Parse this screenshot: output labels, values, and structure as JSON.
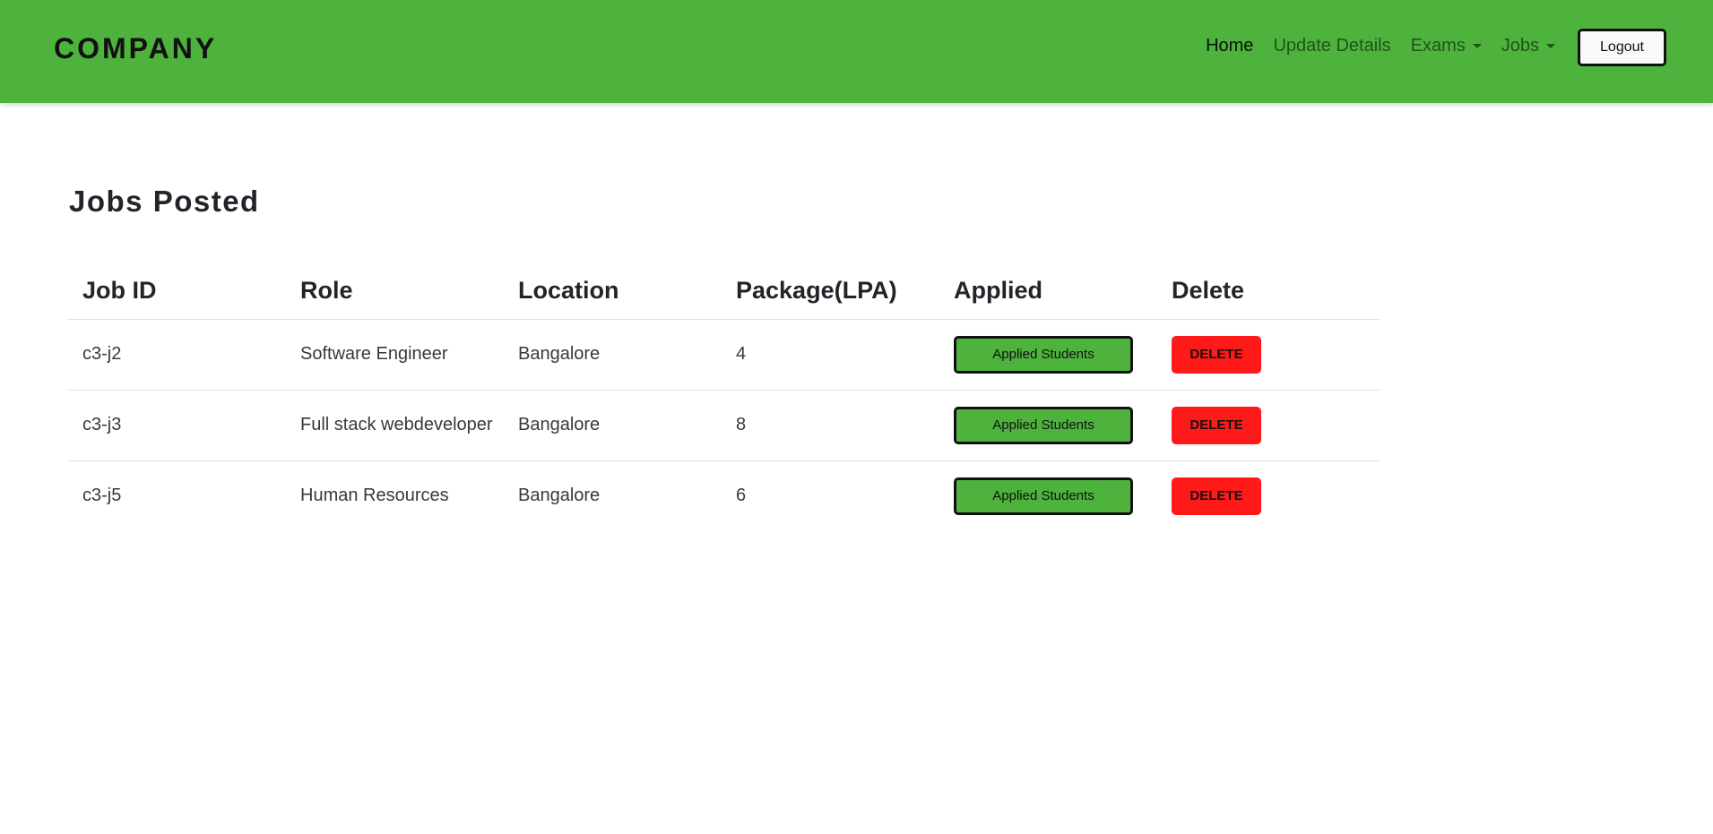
{
  "navbar": {
    "brand": "COMPANY",
    "links": {
      "home": "Home",
      "update_details": "Update Details",
      "exams": "Exams",
      "jobs": "Jobs"
    },
    "logout_label": "Logout",
    "background_color": "#4db33d"
  },
  "page": {
    "title": "Jobs Posted"
  },
  "table": {
    "headers": [
      "Job ID",
      "Role",
      "Location",
      "Package(LPA)",
      "Applied",
      "Delete"
    ],
    "rows": [
      {
        "job_id": "c3-j2",
        "role": "Software Engineer",
        "location": "Bangalore",
        "package": "4",
        "applied_label": "Applied Students",
        "delete_label": "DELETE"
      },
      {
        "job_id": "c3-j3",
        "role": "Full stack webdeveloper",
        "location": "Bangalore",
        "package": "8",
        "applied_label": "Applied Students",
        "delete_label": "DELETE"
      },
      {
        "job_id": "c3-j5",
        "role": "Human Resources",
        "location": "Bangalore",
        "package": "6",
        "applied_label": "Applied Students",
        "delete_label": "DELETE"
      }
    ]
  },
  "colors": {
    "applied_button": "#4db33d",
    "delete_button": "#ff1a1a"
  }
}
